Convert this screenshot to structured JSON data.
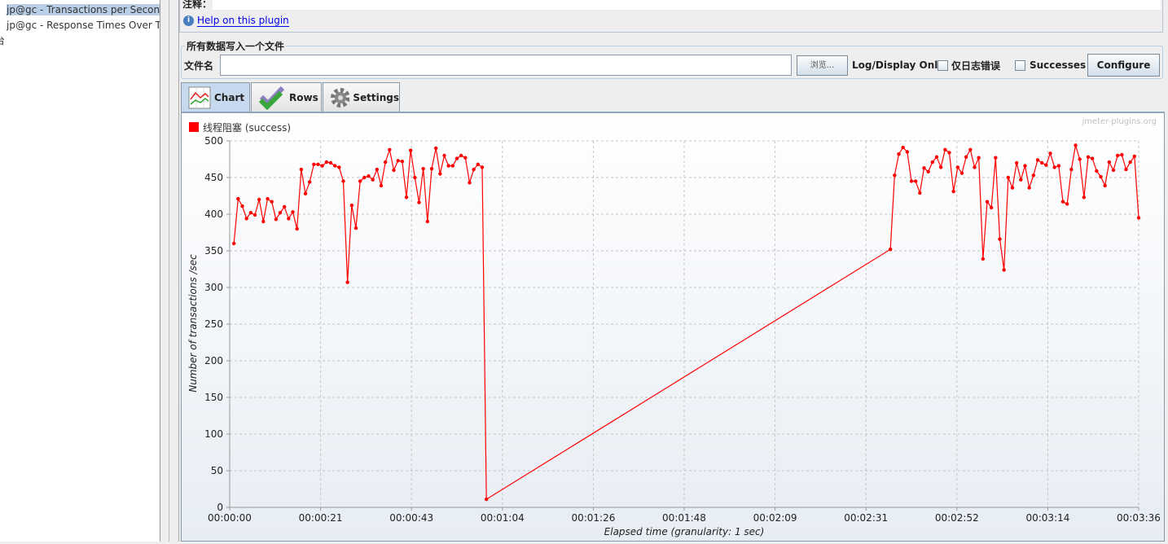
{
  "tree": {
    "items": [
      {
        "label": "jp@gc - Transactions per Second",
        "selected": true
      },
      {
        "label": "jp@gc - Response Times Over Time",
        "selected": false
      },
      {
        "label": "台",
        "selected": false
      }
    ]
  },
  "notes": {
    "label": "注释：",
    "help_link": "Help on this plugin"
  },
  "file_panel": {
    "title": "所有数据写入一个文件",
    "filename_label": "文件名",
    "filename_value": "",
    "browse_label": "浏览...",
    "log_display_label": "Log/Display Only:",
    "errors_label": "仅日志错误",
    "errors_checked": false,
    "successes_label": "Successes",
    "successes_checked": false,
    "configure_label": "Configure"
  },
  "tabs": [
    {
      "label": "Chart",
      "icon": "chart-icon",
      "active": true
    },
    {
      "label": "Rows",
      "icon": "checkmark-icon",
      "active": false
    },
    {
      "label": "Settings",
      "icon": "gear-icon",
      "active": false
    }
  ],
  "watermark": "jmeter-plugins.org",
  "chart_data": {
    "type": "line",
    "xlabel": "Elapsed time (granularity: 1 sec)",
    "ylabel": "Number of transactions /sec",
    "xlim": [
      0,
      216
    ],
    "ylim": [
      0,
      500
    ],
    "grid": true,
    "legend_placement": "top-left",
    "x_ticks": [
      "00:00:00",
      "00:00:21",
      "00:00:43",
      "00:01:04",
      "00:01:26",
      "00:01:48",
      "00:02:09",
      "00:02:31",
      "00:02:52",
      "00:03:14",
      "00:03:36"
    ],
    "y_ticks": [
      0,
      50,
      100,
      150,
      200,
      250,
      300,
      350,
      400,
      450,
      500
    ],
    "series": [
      {
        "name": "线程阻塞 (success)",
        "color": "#ff0000",
        "x_start": 1,
        "x_step": 1,
        "segments": [
          {
            "start": 1,
            "values": [
              360,
              421,
              411,
              394,
              402,
              399,
              420,
              390,
              421,
              417,
              393,
              402,
              410,
              394,
              403,
              380,
              461,
              428,
              444,
              468,
              468,
              466,
              471,
              470,
              466,
              464,
              445,
              307,
              412,
              381,
              445,
              450,
              452,
              447,
              461,
              439,
              471,
              488,
              460,
              473,
              472,
              423,
              487,
              450,
              416,
              462,
              390,
              462,
              490,
              455,
              480,
              466,
              466,
              476,
              480,
              477,
              443,
              461,
              468,
              464,
              11
            ]
          },
          {
            "start": 157,
            "values": [
              352,
              453,
              482,
              491,
              485,
              445,
              445,
              429,
              463,
              458,
              471,
              478,
              464,
              488,
              484,
              431,
              464,
              456,
              478,
              488,
              464,
              477,
              339,
              417,
              409,
              477,
              366,
              324,
              450,
              436,
              470,
              447,
              466,
              436,
              453,
              474,
              470,
              467,
              483,
              464,
              466,
              417,
              414,
              461,
              494,
              475,
              423,
              478,
              476,
              459,
              451,
              439,
              471,
              460,
              480,
              481,
              461,
              471,
              479,
              395
            ]
          }
        ]
      }
    ]
  }
}
